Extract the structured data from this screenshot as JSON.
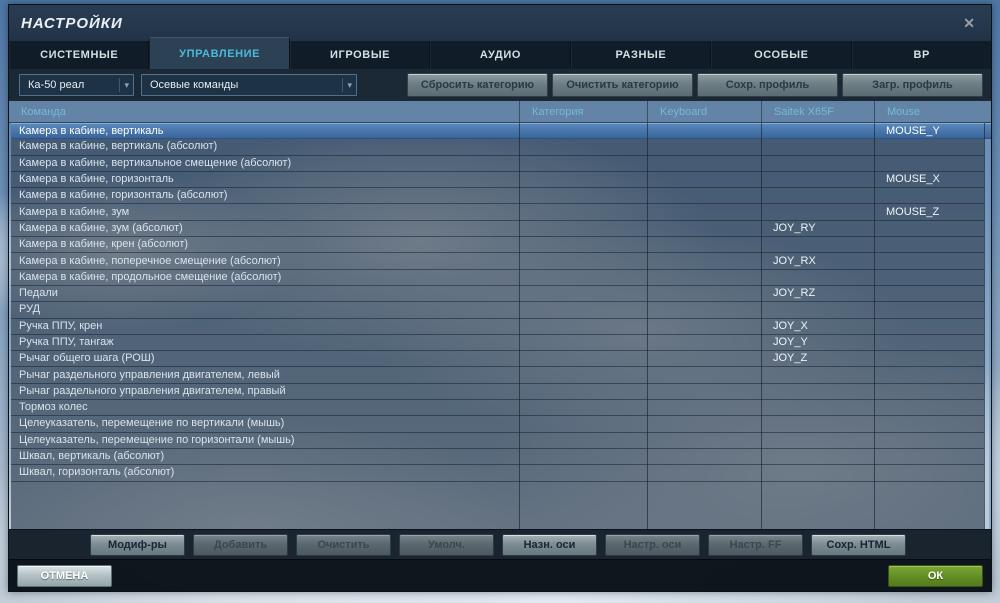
{
  "window": {
    "title": "НАСТРОЙКИ",
    "close_icon": "✕"
  },
  "tabs": [
    {
      "label": "СИСТЕМНЫЕ",
      "active": false
    },
    {
      "label": "УПРАВЛЕНИЕ",
      "active": true
    },
    {
      "label": "ИГРОВЫЕ",
      "active": false
    },
    {
      "label": "АУДИО",
      "active": false
    },
    {
      "label": "РАЗНЫЕ",
      "active": false
    },
    {
      "label": "ОСОБЫЕ",
      "active": false
    },
    {
      "label": "ВР",
      "active": false
    }
  ],
  "toolbar": {
    "aircraft_dropdown": {
      "value": "Ка-50 реал",
      "chevron_icon": "▾"
    },
    "category_dropdown": {
      "value": "Осевые команды",
      "chevron_icon": "▾"
    },
    "buttons": [
      "Сбросить категорию",
      "Очистить категорию",
      "Сохр. профиль",
      "Загр. профиль"
    ]
  },
  "table": {
    "columns": [
      "Команда",
      "Категория",
      "Keyboard",
      "Saitek X65F",
      "Mouse"
    ],
    "rows": [
      {
        "command": "Камера в кабине, вертикаль",
        "category": "",
        "keyboard": "",
        "saitek": "",
        "mouse": "MOUSE_Y",
        "selected": true
      },
      {
        "command": "Камера в кабине, вертикаль (абсолют)",
        "category": "",
        "keyboard": "",
        "saitek": "",
        "mouse": "",
        "selected": false
      },
      {
        "command": "Камера в кабине, вертикальное смещение (абсолют)",
        "category": "",
        "keyboard": "",
        "saitek": "",
        "mouse": "",
        "selected": false
      },
      {
        "command": "Камера в кабине, горизонталь",
        "category": "",
        "keyboard": "",
        "saitek": "",
        "mouse": "MOUSE_X",
        "selected": false
      },
      {
        "command": "Камера в кабине, горизонталь (абсолют)",
        "category": "",
        "keyboard": "",
        "saitek": "",
        "mouse": "",
        "selected": false
      },
      {
        "command": "Камера в кабине, зум",
        "category": "",
        "keyboard": "",
        "saitek": "",
        "mouse": "MOUSE_Z",
        "selected": false
      },
      {
        "command": "Камера в кабине, зум (абсолют)",
        "category": "",
        "keyboard": "",
        "saitek": "JOY_RY",
        "mouse": "",
        "selected": false
      },
      {
        "command": "Камера в кабине, крен (абсолют)",
        "category": "",
        "keyboard": "",
        "saitek": "",
        "mouse": "",
        "selected": false
      },
      {
        "command": "Камера в кабине, поперечное смещение (абсолют)",
        "category": "",
        "keyboard": "",
        "saitek": "JOY_RX",
        "mouse": "",
        "selected": false
      },
      {
        "command": "Камера в кабине, продольное смещение (абсолют)",
        "category": "",
        "keyboard": "",
        "saitek": "",
        "mouse": "",
        "selected": false
      },
      {
        "command": "Педали",
        "category": "",
        "keyboard": "",
        "saitek": "JOY_RZ",
        "mouse": "",
        "selected": false
      },
      {
        "command": "РУД",
        "category": "",
        "keyboard": "",
        "saitek": "",
        "mouse": "",
        "selected": false
      },
      {
        "command": "Ручка ППУ, крен",
        "category": "",
        "keyboard": "",
        "saitek": "JOY_X",
        "mouse": "",
        "selected": false
      },
      {
        "command": "Ручка ППУ, тангаж",
        "category": "",
        "keyboard": "",
        "saitek": "JOY_Y",
        "mouse": "",
        "selected": false
      },
      {
        "command": "Рычаг общего шага (РОШ)",
        "category": "",
        "keyboard": "",
        "saitek": "JOY_Z",
        "mouse": "",
        "selected": false
      },
      {
        "command": "Рычаг раздельного управления двигателем, левый",
        "category": "",
        "keyboard": "",
        "saitek": "",
        "mouse": "",
        "selected": false
      },
      {
        "command": "Рычаг раздельного управления двигателем, правый",
        "category": "",
        "keyboard": "",
        "saitek": "",
        "mouse": "",
        "selected": false
      },
      {
        "command": "Тормоз колес",
        "category": "",
        "keyboard": "",
        "saitek": "",
        "mouse": "",
        "selected": false
      },
      {
        "command": "Целеуказатель, перемещение по вертикали (мышь)",
        "category": "",
        "keyboard": "",
        "saitek": "",
        "mouse": "",
        "selected": false
      },
      {
        "command": "Целеуказатель, перемещение по горизонтали (мышь)",
        "category": "",
        "keyboard": "",
        "saitek": "",
        "mouse": "",
        "selected": false
      },
      {
        "command": "Шквал, вертикаль (абсолют)",
        "category": "",
        "keyboard": "",
        "saitek": "",
        "mouse": "",
        "selected": false
      },
      {
        "command": "Шквал, горизонталь (абсолют)",
        "category": "",
        "keyboard": "",
        "saitek": "",
        "mouse": "",
        "selected": false
      }
    ]
  },
  "action_buttons": [
    {
      "label": "Модиф-ры",
      "enabled": true
    },
    {
      "label": "Добавить",
      "enabled": false
    },
    {
      "label": "Очистить",
      "enabled": false
    },
    {
      "label": "Умолч.",
      "enabled": false
    },
    {
      "label": "Назн. оси",
      "enabled": true
    },
    {
      "label": "Настр. оси",
      "enabled": false
    },
    {
      "label": "Настр. FF",
      "enabled": false
    },
    {
      "label": "Сохр. HTML",
      "enabled": true
    }
  ],
  "footer": {
    "cancel_label": "ОТМЕНА",
    "ok_label": "ОК"
  },
  "colors": {
    "selected_row": "#4a7cb0",
    "active_tab_text": "#4cb9dc",
    "header_text": "#74b9d9",
    "ok_button": "#648f26",
    "cancel_button": "#b4c2c6",
    "titlebar": "#253748"
  }
}
